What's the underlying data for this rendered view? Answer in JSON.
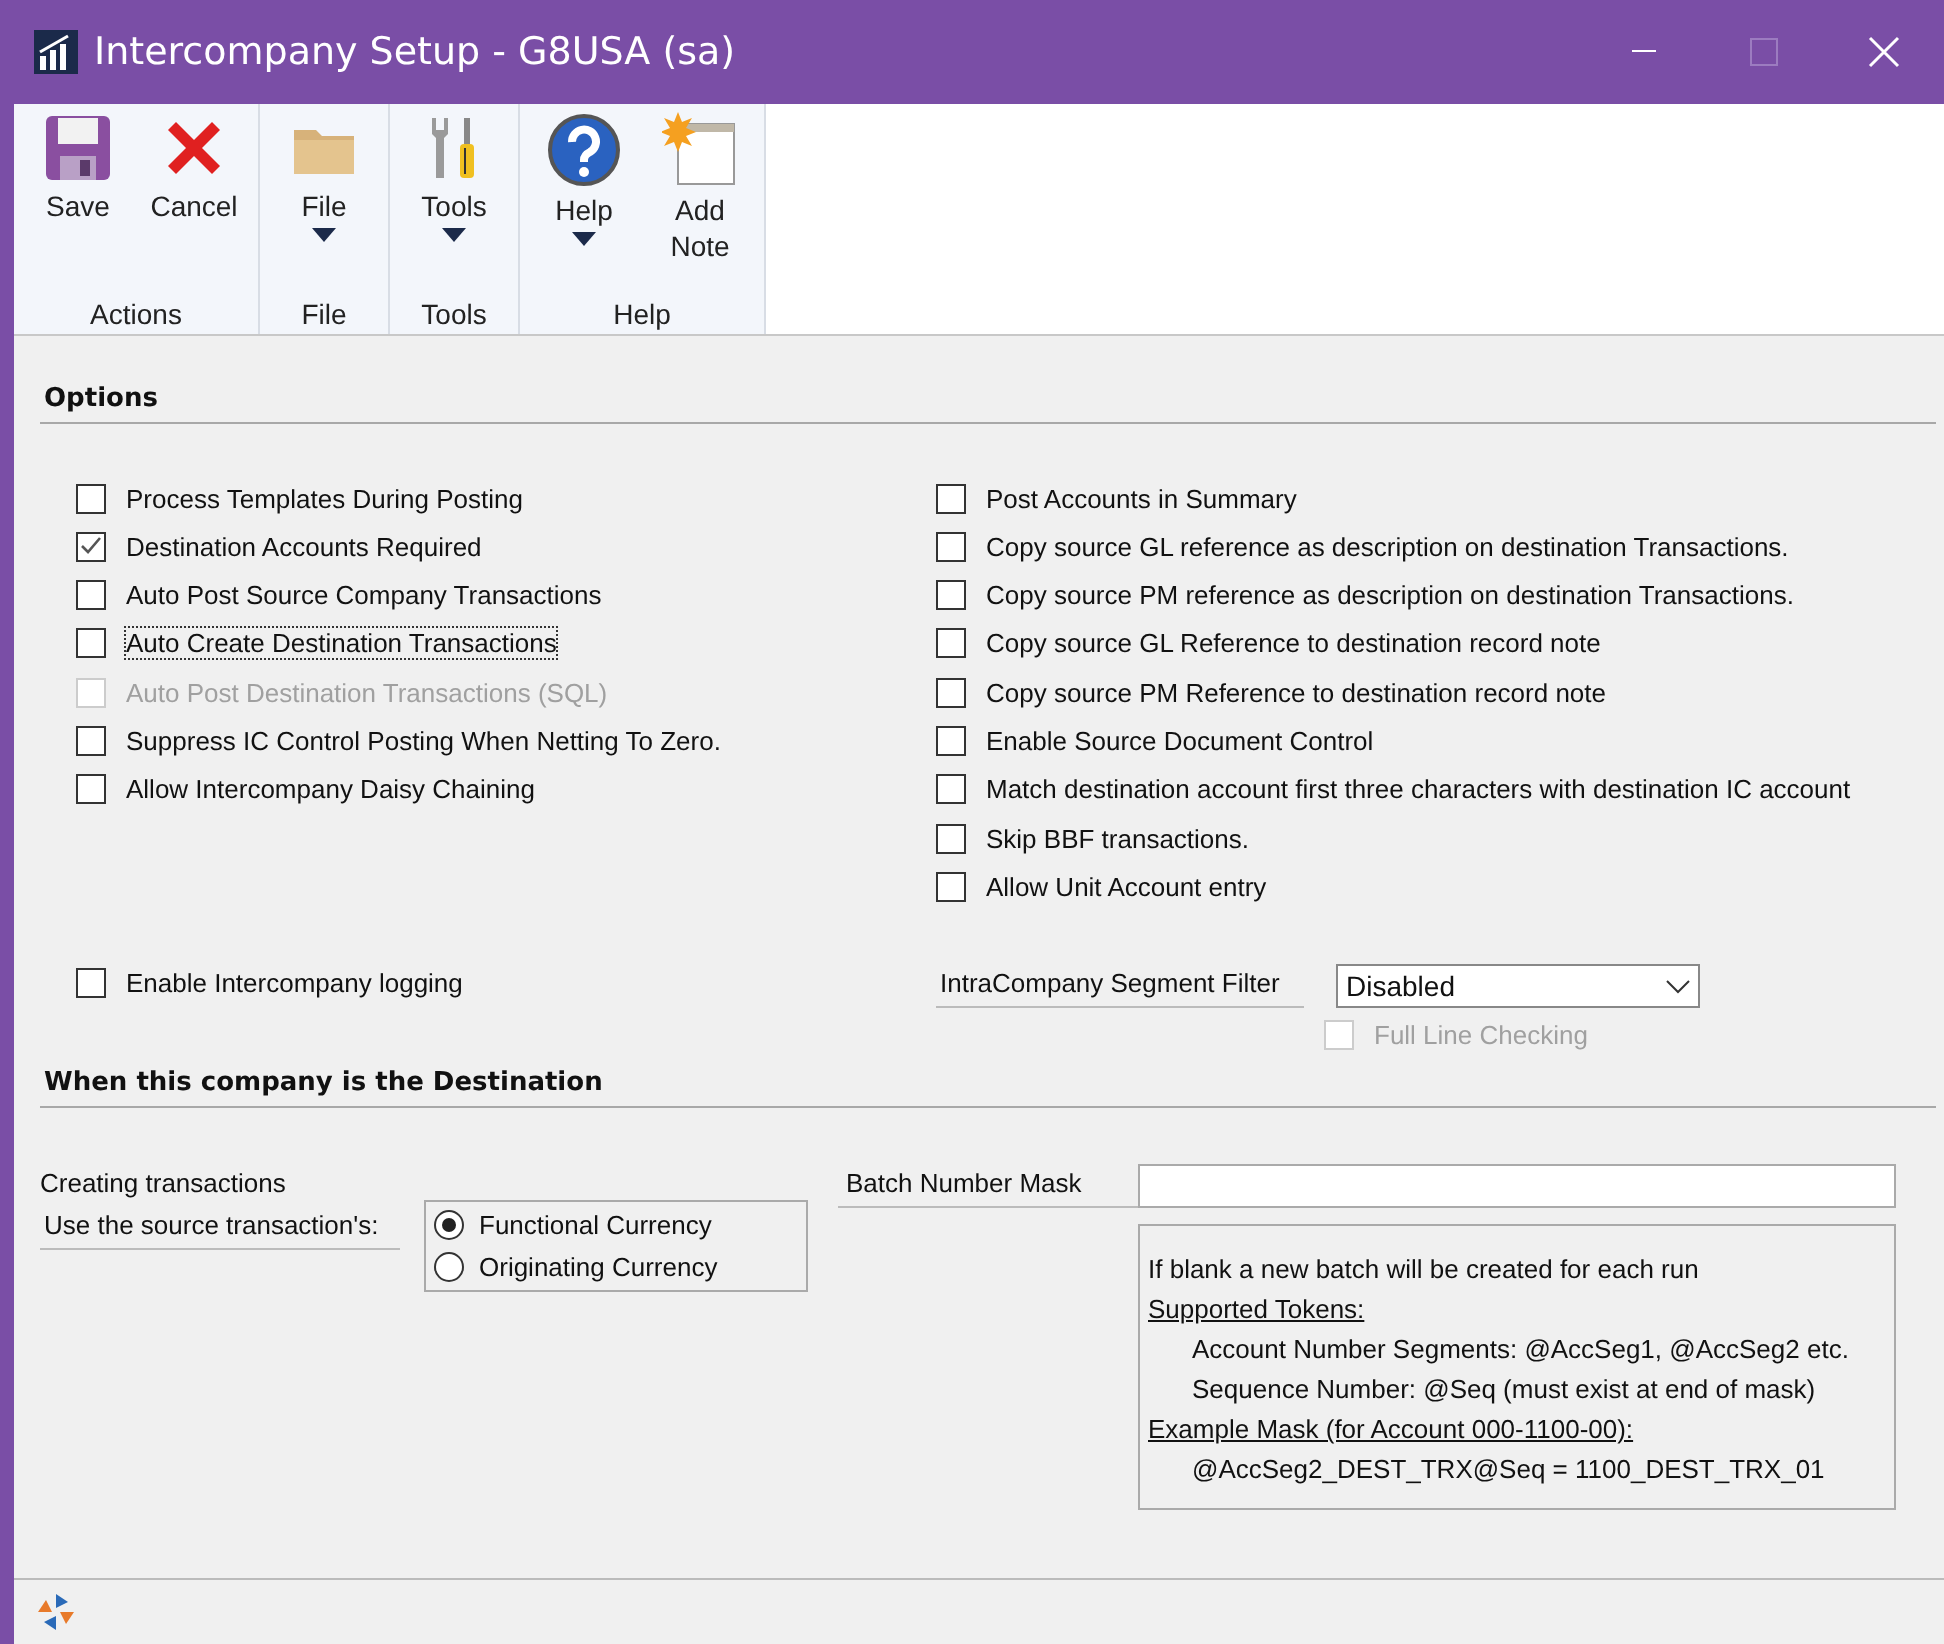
{
  "window": {
    "title": "Intercompany Setup  -  G8USA (sa)"
  },
  "ribbon": [
    {
      "label": "Actions",
      "buttons": [
        {
          "label": "Save",
          "dropdown": false
        },
        {
          "label": "Cancel",
          "dropdown": false
        }
      ]
    },
    {
      "label": "File",
      "buttons": [
        {
          "label": "File",
          "dropdown": true
        }
      ]
    },
    {
      "label": "Tools",
      "buttons": [
        {
          "label": "Tools",
          "dropdown": true
        }
      ]
    },
    {
      "label": "Help",
      "buttons": [
        {
          "label": "Help",
          "dropdown": true
        },
        {
          "label": "Add Note",
          "dropdown": false
        }
      ]
    }
  ],
  "options": {
    "title": "Options",
    "left": [
      {
        "label": "Process Templates During Posting",
        "checked": false,
        "disabled": false,
        "focused": false
      },
      {
        "label": "Destination Accounts Required",
        "checked": true,
        "disabled": false,
        "focused": false
      },
      {
        "label": "Auto Post Source Company Transactions",
        "checked": false,
        "disabled": false,
        "focused": false
      },
      {
        "label": "Auto Create Destination Transactions",
        "checked": false,
        "disabled": false,
        "focused": true
      },
      {
        "label": "Auto Post Destination Transactions (SQL)",
        "checked": false,
        "disabled": true,
        "focused": false
      },
      {
        "label": "Suppress IC Control Posting When Netting To Zero.",
        "checked": false,
        "disabled": false,
        "focused": false
      },
      {
        "label": "Allow Intercompany Daisy Chaining",
        "checked": false,
        "disabled": false,
        "focused": false
      }
    ],
    "right": [
      {
        "label": "Post Accounts in Summary",
        "checked": false,
        "disabled": false,
        "focused": false
      },
      {
        "label": "Copy source GL reference as description on destination Transactions.",
        "checked": false,
        "disabled": false,
        "focused": false
      },
      {
        "label": "Copy source PM reference as description on destination Transactions.",
        "checked": false,
        "disabled": false,
        "focused": false
      },
      {
        "label": "Copy source GL Reference to destination record note",
        "checked": false,
        "disabled": false,
        "focused": false
      },
      {
        "label": "Copy source PM Reference to destination record note",
        "checked": false,
        "disabled": false,
        "focused": false
      },
      {
        "label": "Enable Source Document Control",
        "checked": false,
        "disabled": false,
        "focused": false
      },
      {
        "label": "Match destination account first three characters with destination IC account",
        "checked": false,
        "disabled": false,
        "focused": false
      },
      {
        "label": "Skip BBF transactions.",
        "checked": false,
        "disabled": false,
        "focused": false
      },
      {
        "label": "Allow Unit Account entry",
        "checked": false,
        "disabled": false,
        "focused": false
      }
    ],
    "logging": {
      "label": "Enable Intercompany logging",
      "checked": false,
      "disabled": false,
      "focused": false
    },
    "segment_filter": {
      "label": "IntraCompany Segment Filter",
      "value": "Disabled"
    },
    "full_line": {
      "label": "Full Line Checking",
      "checked": false,
      "disabled": true,
      "focused": false
    }
  },
  "destination": {
    "title": "When this company is the Destination",
    "creating_label": "Creating transactions",
    "source_label": "Use the source transaction's:",
    "currency": [
      {
        "label": "Functional Currency",
        "selected": true
      },
      {
        "label": "Originating Currency",
        "selected": false
      }
    ],
    "batch_label": "Batch Number Mask",
    "notes": [
      {
        "kind": "plain",
        "text": "If blank a new batch will be created for each run"
      },
      {
        "kind": "heading",
        "text": "Supported Tokens:"
      },
      {
        "kind": "indent",
        "text": "Account Number Segments: @AccSeg1, @AccSeg2  etc."
      },
      {
        "kind": "indent",
        "text": "Sequence Number: @Seq (must exist at end of mask)"
      },
      {
        "kind": "heading",
        "text": "Example Mask (for Account 000-1100-00):"
      },
      {
        "kind": "indent",
        "text": "@AccSeg2_DEST_TRX@Seq = 1100_DEST_TRX_01"
      }
    ]
  }
}
